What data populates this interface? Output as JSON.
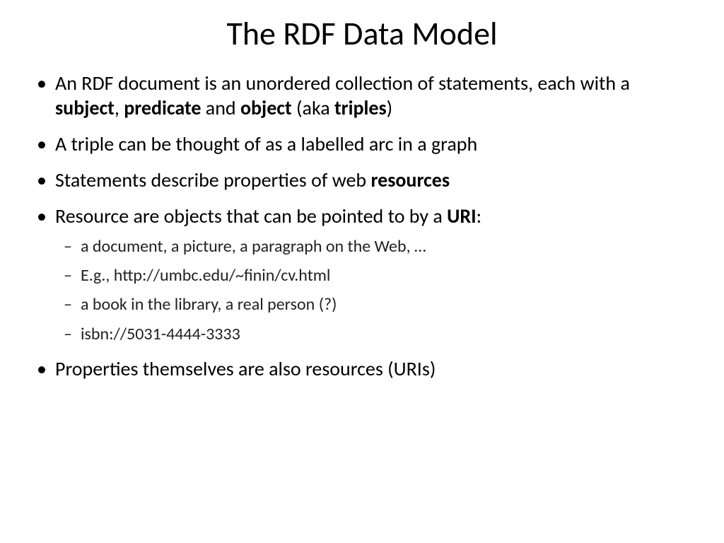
{
  "title": "The RDF Data Model",
  "bullets": {
    "b1": {
      "t1": "An RDF document is an unordered collection of statements, each with a ",
      "bold1": "subject",
      "t2": ", ",
      "bold2": "predicate",
      "t3": " and ",
      "bold3": "object",
      "t4": " (aka ",
      "bold4": "triples",
      "t5": ")"
    },
    "b2": "A triple can be thought of as a labelled arc in a graph",
    "b3": {
      "t1": "Statements describe properties of web ",
      "bold1": "resources"
    },
    "b4": {
      "t1": "Resource are objects that can be pointed to by a ",
      "bold1": "URI",
      "t2": ":"
    },
    "sub": {
      "s1": "a document, a picture, a paragraph on the Web, …",
      "s2": "E.g., http://umbc.edu/~finin/cv.html",
      "s3": "a book in the library, a real person (?)",
      "s4": "isbn://5031-4444-3333"
    },
    "b5": "Properties themselves are also resources (URIs)"
  }
}
